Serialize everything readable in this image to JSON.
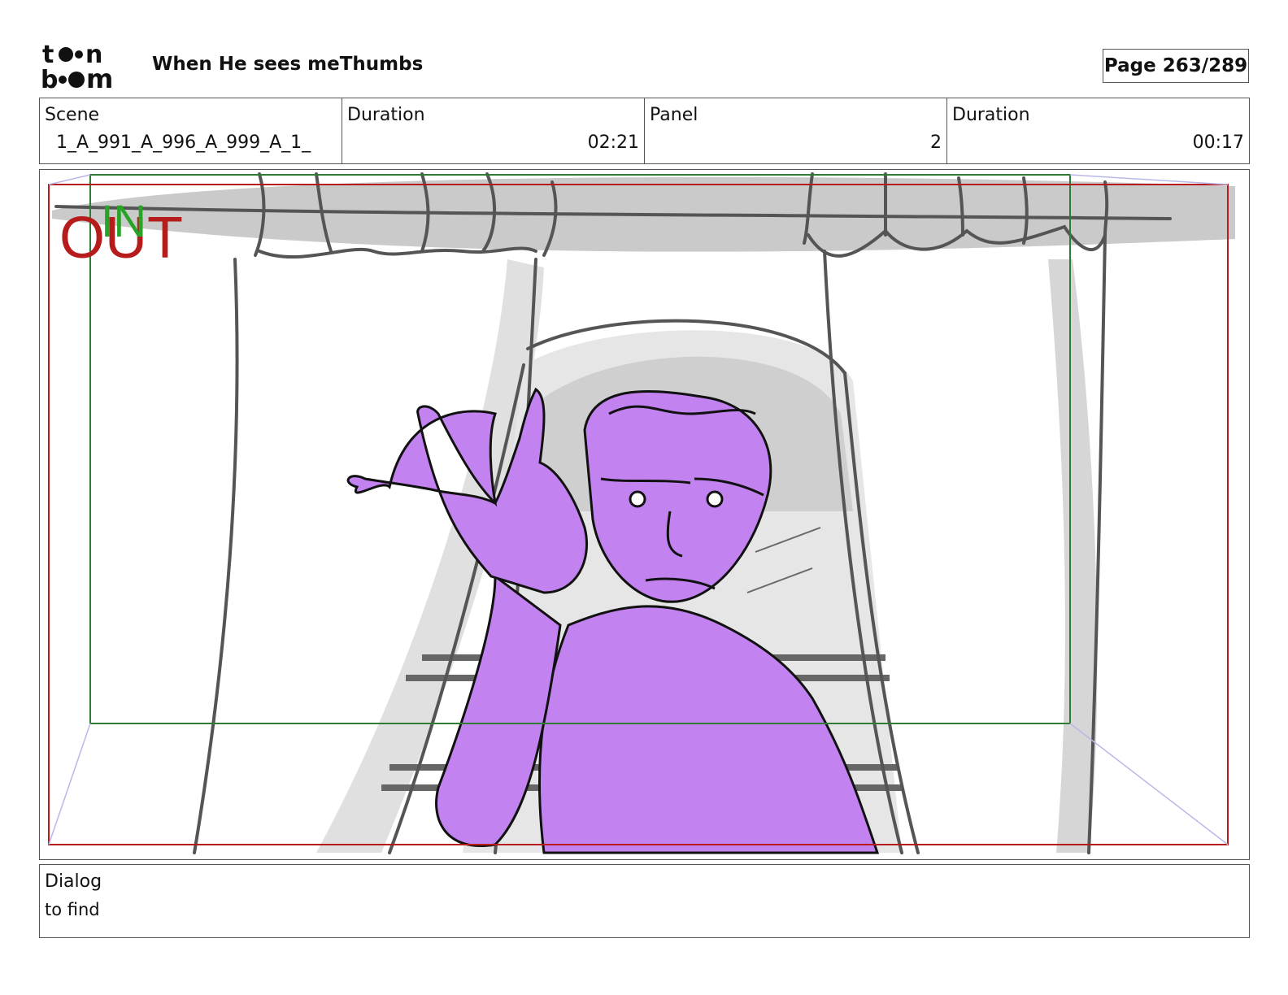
{
  "header": {
    "logo_text": "toon boom",
    "title": "When He sees meThumbs",
    "page": "Page 263/289"
  },
  "info": {
    "scene_label": "Scene",
    "scene_value": "1_A_991_A_996_A_999_A_1_",
    "scene_duration_label": "Duration",
    "scene_duration_value": "02:21",
    "panel_label": "Panel",
    "panel_value": "2",
    "panel_duration_label": "Duration",
    "panel_duration_value": "00:17"
  },
  "panel": {
    "in_label": "IN",
    "out_label": "OUT",
    "colors": {
      "in_frame": "#2e7d32",
      "out_frame": "#b71c1c",
      "character_fill": "#c283f0",
      "sketch_line": "#555555",
      "shade": "#c8c8c8"
    }
  },
  "dialog": {
    "label": "Dialog",
    "text": "to find"
  }
}
